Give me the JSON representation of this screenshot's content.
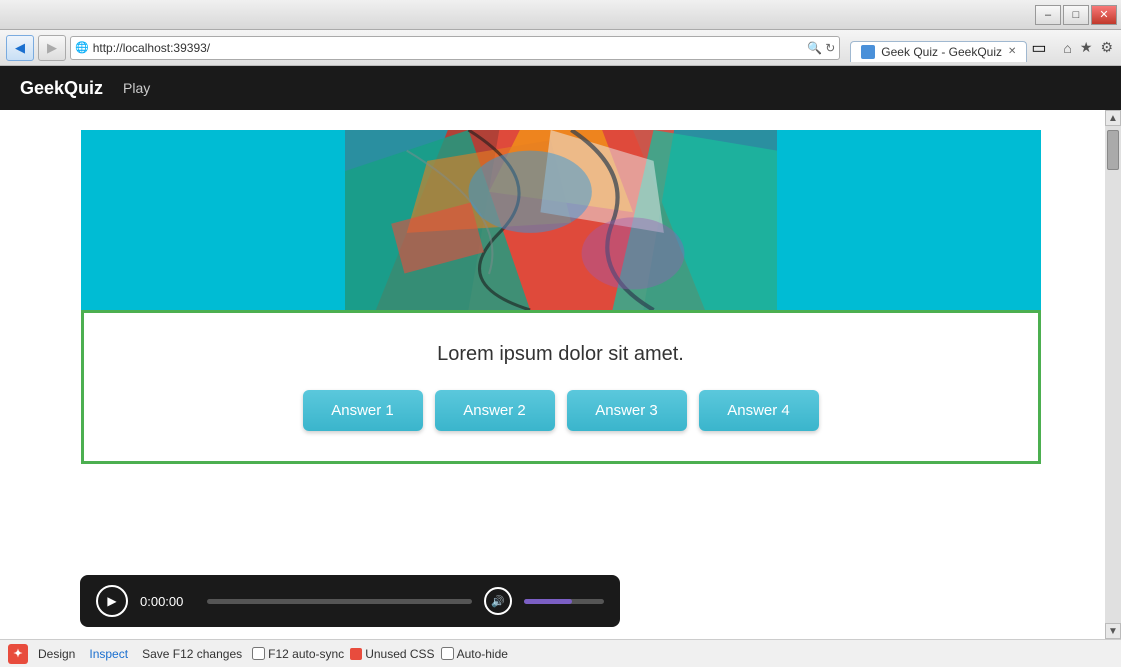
{
  "browser": {
    "title_bar_buttons": {
      "minimize": "–",
      "maximize": "□",
      "close": "✕"
    },
    "nav": {
      "back_icon": "◀",
      "forward_icon": "▶",
      "address": "http://localhost:39393/",
      "search_icon": "🔍",
      "refresh_icon": "↻"
    },
    "tab": {
      "favicon_alt": "GeekQuiz favicon",
      "label": "Geek Quiz - GeekQuiz",
      "close": "✕"
    },
    "toolbar": {
      "home_icon": "⌂",
      "star_icon": "★",
      "gear_icon": "⚙"
    }
  },
  "app": {
    "brand": "GeekQuiz",
    "nav_link": "Play"
  },
  "quiz": {
    "question": "Lorem ipsum dolor sit amet.",
    "answers": [
      "Answer 1",
      "Answer 2",
      "Answer 3",
      "Answer 4"
    ]
  },
  "media": {
    "time": "0:00:00",
    "play_icon": "▶"
  },
  "dev_bar": {
    "logo": "✦",
    "buttons": [
      "Design",
      "Inspect",
      "Save F12 changes",
      "F12 auto-sync",
      "Unused CSS",
      "Auto-hide"
    ]
  }
}
